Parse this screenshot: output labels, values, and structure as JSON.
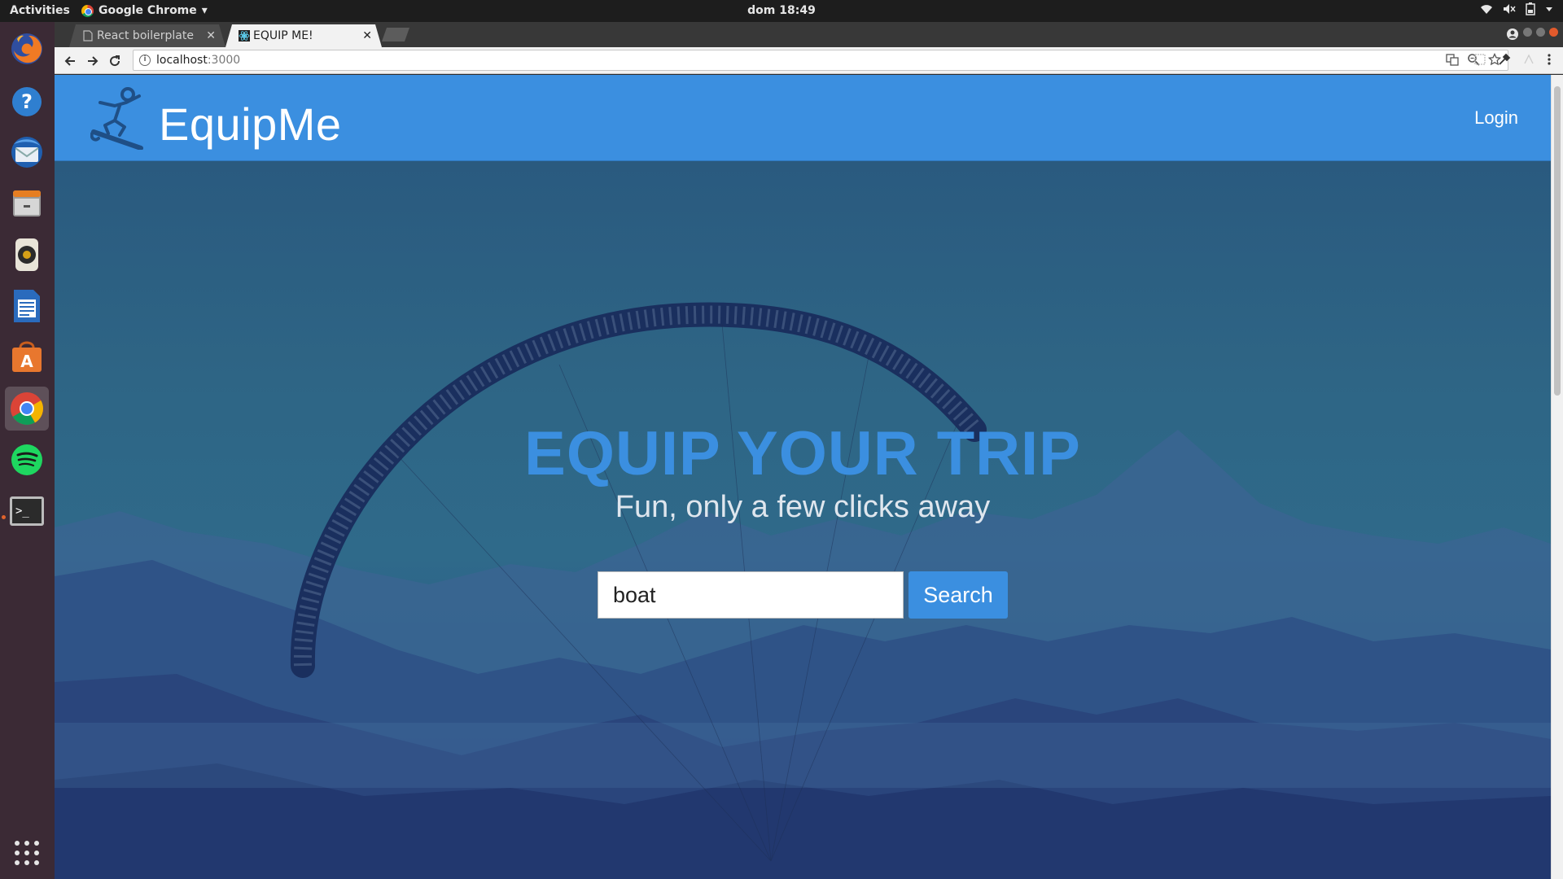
{
  "system_bar": {
    "activities": "Activities",
    "app_name": "Google Chrome",
    "clock": "dom 18:49"
  },
  "dock": {
    "items": [
      "firefox-icon",
      "help-icon",
      "thunderbird-icon",
      "files-icon",
      "rhythmbox-icon",
      "writer-icon",
      "software-icon",
      "chrome-icon",
      "spotify-icon",
      "terminal-icon",
      "apps-grid-icon"
    ]
  },
  "browser": {
    "tabs": [
      {
        "title": "React boilerplate",
        "active": false
      },
      {
        "title": "EQUIP ME!",
        "active": true
      }
    ],
    "address": {
      "host": "localhost",
      "port": ":3000"
    }
  },
  "site": {
    "brand": "EquipMe",
    "login": "Login",
    "hero_title": "EQUIP YOUR TRIP",
    "hero_subtitle": "Fun, only a few clicks away",
    "search_value": "boat",
    "search_button": "Search"
  },
  "colors": {
    "brand_blue": "#3b8fe0",
    "dock_bg": "#3b2a35",
    "topbar_bg": "#1d1d1d"
  }
}
